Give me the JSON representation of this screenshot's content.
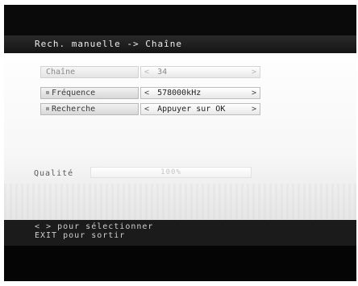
{
  "title_bar": {
    "text": "Rech. manuelle -> Chaîne"
  },
  "rows": [
    {
      "label": "Chaîne",
      "value": "34",
      "left_arrow": "<",
      "right_arrow": ">",
      "bullet": false,
      "dimmed": true
    },
    {
      "label": "Fréquence",
      "value": "578000kHz",
      "left_arrow": "<",
      "right_arrow": ">",
      "bullet": true,
      "dimmed": false
    },
    {
      "label": "Recherche",
      "value": "Appuyer sur OK",
      "left_arrow": "<",
      "right_arrow": ">",
      "bullet": true,
      "dimmed": false
    }
  ],
  "quality": {
    "label": "Qualité",
    "value_text": "100%",
    "level": 1.0
  },
  "help": {
    "line1": "< > pour sélectionner",
    "line2": "EXIT pour sortir"
  },
  "colors": {
    "title_bg": "#1f1f1f",
    "help_bg": "#1b1b1b",
    "frame": "#0a0a0a"
  }
}
